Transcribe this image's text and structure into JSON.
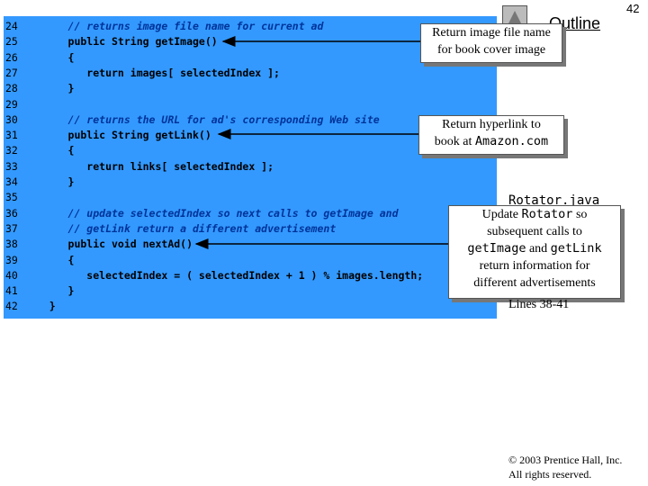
{
  "page": {
    "number": "42",
    "outline_title": "Outline"
  },
  "code": {
    "lines": [
      {
        "num": "24",
        "text": "      // returns image file name for current ad",
        "type": "comment"
      },
      {
        "num": "25",
        "text": "      public String getImage()",
        "type": "code"
      },
      {
        "num": "26",
        "text": "      {",
        "type": "code"
      },
      {
        "num": "27",
        "text": "         return images[ selectedIndex ];",
        "type": "code"
      },
      {
        "num": "28",
        "text": "      }",
        "type": "code"
      },
      {
        "num": "29",
        "text": "",
        "type": "code"
      },
      {
        "num": "30",
        "text": "      // returns the URL for ad's corresponding Web site",
        "type": "comment"
      },
      {
        "num": "31",
        "text": "      public String getLink()",
        "type": "code"
      },
      {
        "num": "32",
        "text": "      {",
        "type": "code"
      },
      {
        "num": "33",
        "text": "         return links[ selectedIndex ];",
        "type": "code"
      },
      {
        "num": "34",
        "text": "      }",
        "type": "code"
      },
      {
        "num": "35",
        "text": "",
        "type": "code"
      },
      {
        "num": "36",
        "text": "      // update selectedIndex so next calls to getImage and",
        "type": "comment"
      },
      {
        "num": "37",
        "text": "      // getLink return a different advertisement",
        "type": "comment"
      },
      {
        "num": "38",
        "text": "      public void nextAd()",
        "type": "code"
      },
      {
        "num": "39",
        "text": "      {",
        "type": "code"
      },
      {
        "num": "40",
        "text": "         selectedIndex = ( selectedIndex + 1 ) % images.length;",
        "type": "code"
      },
      {
        "num": "41",
        "text": "      }",
        "type": "code"
      },
      {
        "num": "42",
        "text": "   }",
        "type": "code"
      }
    ]
  },
  "callouts": {
    "image": {
      "line1": "Return image file name",
      "line2": "for book cover image"
    },
    "link": {
      "line1": "Return hyperlink to",
      "line2_prefix": "book at ",
      "line2_mono": "Amazon.com"
    },
    "update": {
      "l1_prefix": "Update ",
      "l1_mono": "Rotator",
      "l1_suffix": " so",
      "l2": "subsequent calls to",
      "l3_mono_a": "getImage",
      "l3_mid": " and ",
      "l3_mono_b": "getLink",
      "l4": "return information for",
      "l5": "different advertisements"
    }
  },
  "side": {
    "file": "Rotator.java",
    "lines": "Lines 38-41"
  },
  "copyright": {
    "line1": "© 2003 Prentice Hall, Inc.",
    "line2": "All rights reserved."
  }
}
